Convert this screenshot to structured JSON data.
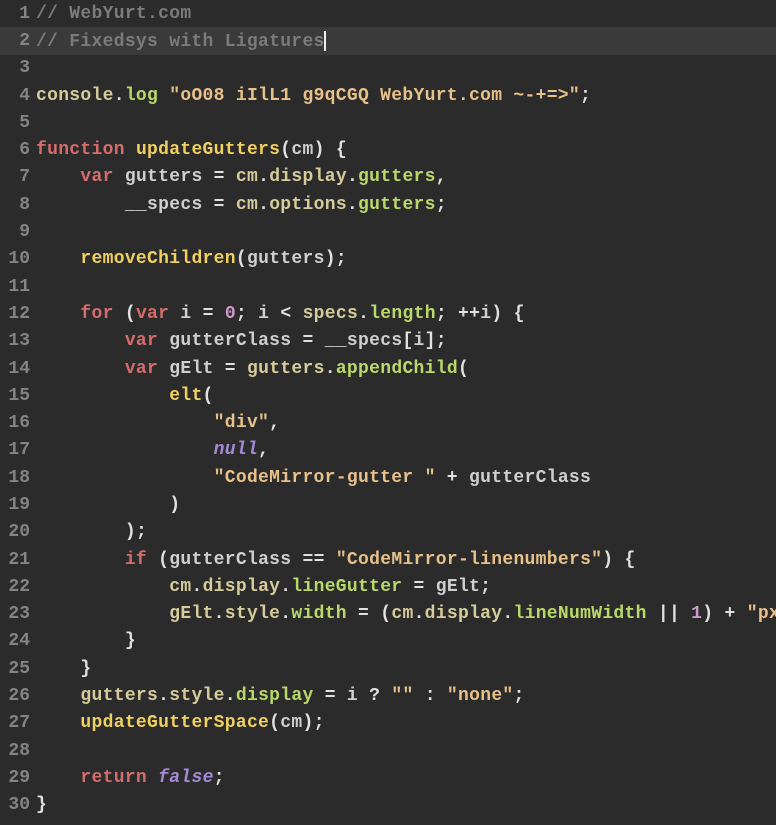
{
  "active_line": 2,
  "lines": [
    {
      "n": 1,
      "tokens": [
        [
          "c-comment",
          "// WebYurt.com"
        ]
      ]
    },
    {
      "n": 2,
      "tokens": [
        [
          "c-comment",
          "// Fixedsys with Ligatures"
        ],
        [
          "cursor",
          ""
        ]
      ]
    },
    {
      "n": 3,
      "tokens": []
    },
    {
      "n": 4,
      "tokens": [
        [
          "c-obj",
          "console"
        ],
        [
          "c-punct",
          "."
        ],
        [
          "c-method",
          "log"
        ],
        [
          "c-default",
          " "
        ],
        [
          "c-string",
          "\"oO08 iIlL1 g9qCGQ WebYurt.com ~-+=>\""
        ],
        [
          "c-punct",
          ";"
        ]
      ]
    },
    {
      "n": 5,
      "tokens": []
    },
    {
      "n": 6,
      "tokens": [
        [
          "c-keyword",
          "function"
        ],
        [
          "c-default",
          " "
        ],
        [
          "c-func",
          "updateGutters"
        ],
        [
          "c-punct",
          "("
        ],
        [
          "c-param",
          "cm"
        ],
        [
          "c-punct",
          ")"
        ],
        [
          "c-default",
          " "
        ],
        [
          "c-brace",
          "{"
        ]
      ]
    },
    {
      "n": 7,
      "tokens": [
        [
          "c-default",
          "    "
        ],
        [
          "c-var",
          "var"
        ],
        [
          "c-default",
          " "
        ],
        [
          "c-ident",
          "gutters"
        ],
        [
          "c-default",
          " "
        ],
        [
          "c-op",
          "="
        ],
        [
          "c-default",
          " "
        ],
        [
          "c-obj",
          "cm"
        ],
        [
          "c-punct",
          "."
        ],
        [
          "c-obj",
          "display"
        ],
        [
          "c-punct",
          "."
        ],
        [
          "c-prop",
          "gutters"
        ],
        [
          "c-punct",
          ","
        ]
      ]
    },
    {
      "n": 8,
      "tokens": [
        [
          "c-default",
          "        "
        ],
        [
          "c-ident",
          "__specs"
        ],
        [
          "c-default",
          " "
        ],
        [
          "c-op",
          "="
        ],
        [
          "c-default",
          " "
        ],
        [
          "c-obj",
          "cm"
        ],
        [
          "c-punct",
          "."
        ],
        [
          "c-obj",
          "options"
        ],
        [
          "c-punct",
          "."
        ],
        [
          "c-prop",
          "gutters"
        ],
        [
          "c-punct",
          ";"
        ]
      ]
    },
    {
      "n": 9,
      "tokens": []
    },
    {
      "n": 10,
      "tokens": [
        [
          "c-default",
          "    "
        ],
        [
          "c-call",
          "removeChildren"
        ],
        [
          "c-punct",
          "("
        ],
        [
          "c-ident",
          "gutters"
        ],
        [
          "c-punct",
          ")"
        ],
        [
          "c-punct",
          ";"
        ]
      ]
    },
    {
      "n": 11,
      "tokens": []
    },
    {
      "n": 12,
      "tokens": [
        [
          "c-default",
          "    "
        ],
        [
          "c-keyword",
          "for"
        ],
        [
          "c-default",
          " "
        ],
        [
          "c-punct",
          "("
        ],
        [
          "c-var",
          "var"
        ],
        [
          "c-default",
          " "
        ],
        [
          "c-ident",
          "i"
        ],
        [
          "c-default",
          " "
        ],
        [
          "c-op",
          "="
        ],
        [
          "c-default",
          " "
        ],
        [
          "c-number",
          "0"
        ],
        [
          "c-punct",
          ";"
        ],
        [
          "c-default",
          " "
        ],
        [
          "c-ident",
          "i"
        ],
        [
          "c-default",
          " "
        ],
        [
          "c-op",
          "<"
        ],
        [
          "c-default",
          " "
        ],
        [
          "c-obj",
          "specs"
        ],
        [
          "c-punct",
          "."
        ],
        [
          "c-prop",
          "length"
        ],
        [
          "c-punct",
          ";"
        ],
        [
          "c-default",
          " "
        ],
        [
          "c-op",
          "++"
        ],
        [
          "c-ident",
          "i"
        ],
        [
          "c-punct",
          ")"
        ],
        [
          "c-default",
          " "
        ],
        [
          "c-brace",
          "{"
        ]
      ]
    },
    {
      "n": 13,
      "tokens": [
        [
          "c-default",
          "        "
        ],
        [
          "c-var",
          "var"
        ],
        [
          "c-default",
          " "
        ],
        [
          "c-ident",
          "gutterClass"
        ],
        [
          "c-default",
          " "
        ],
        [
          "c-op",
          "="
        ],
        [
          "c-default",
          " "
        ],
        [
          "c-ident",
          "__specs"
        ],
        [
          "c-punct",
          "["
        ],
        [
          "c-ident",
          "i"
        ],
        [
          "c-punct",
          "]"
        ],
        [
          "c-punct",
          ";"
        ]
      ]
    },
    {
      "n": 14,
      "tokens": [
        [
          "c-default",
          "        "
        ],
        [
          "c-var",
          "var"
        ],
        [
          "c-default",
          " "
        ],
        [
          "c-ident",
          "gElt"
        ],
        [
          "c-default",
          " "
        ],
        [
          "c-op",
          "="
        ],
        [
          "c-default",
          " "
        ],
        [
          "c-obj",
          "gutters"
        ],
        [
          "c-punct",
          "."
        ],
        [
          "c-method",
          "appendChild"
        ],
        [
          "c-punct",
          "("
        ]
      ]
    },
    {
      "n": 15,
      "tokens": [
        [
          "c-default",
          "            "
        ],
        [
          "c-call",
          "elt"
        ],
        [
          "c-punct",
          "("
        ]
      ]
    },
    {
      "n": 16,
      "tokens": [
        [
          "c-default",
          "                "
        ],
        [
          "c-string",
          "\"div\""
        ],
        [
          "c-punct",
          ","
        ]
      ]
    },
    {
      "n": 17,
      "tokens": [
        [
          "c-default",
          "                "
        ],
        [
          "c-const",
          "null"
        ],
        [
          "c-punct",
          ","
        ]
      ]
    },
    {
      "n": 18,
      "tokens": [
        [
          "c-default",
          "                "
        ],
        [
          "c-string",
          "\"CodeMirror-gutter \""
        ],
        [
          "c-default",
          " "
        ],
        [
          "c-op",
          "+"
        ],
        [
          "c-default",
          " "
        ],
        [
          "c-ident",
          "gutterClass"
        ]
      ]
    },
    {
      "n": 19,
      "tokens": [
        [
          "c-default",
          "            "
        ],
        [
          "c-punct",
          ")"
        ]
      ]
    },
    {
      "n": 20,
      "tokens": [
        [
          "c-default",
          "        "
        ],
        [
          "c-punct",
          ")"
        ],
        [
          "c-punct",
          ";"
        ]
      ]
    },
    {
      "n": 21,
      "tokens": [
        [
          "c-default",
          "        "
        ],
        [
          "c-keyword",
          "if"
        ],
        [
          "c-default",
          " "
        ],
        [
          "c-punct",
          "("
        ],
        [
          "c-ident",
          "gutterClass"
        ],
        [
          "c-default",
          " "
        ],
        [
          "c-op",
          "=="
        ],
        [
          "c-default",
          " "
        ],
        [
          "c-string",
          "\"CodeMirror-linenumbers\""
        ],
        [
          "c-punct",
          ")"
        ],
        [
          "c-default",
          " "
        ],
        [
          "c-brace",
          "{"
        ]
      ]
    },
    {
      "n": 22,
      "tokens": [
        [
          "c-default",
          "            "
        ],
        [
          "c-obj",
          "cm"
        ],
        [
          "c-punct",
          "."
        ],
        [
          "c-obj",
          "display"
        ],
        [
          "c-punct",
          "."
        ],
        [
          "c-prop",
          "lineGutter"
        ],
        [
          "c-default",
          " "
        ],
        [
          "c-op",
          "="
        ],
        [
          "c-default",
          " "
        ],
        [
          "c-ident",
          "gElt"
        ],
        [
          "c-punct",
          ";"
        ]
      ]
    },
    {
      "n": 23,
      "tokens": [
        [
          "c-default",
          "            "
        ],
        [
          "c-obj",
          "gElt"
        ],
        [
          "c-punct",
          "."
        ],
        [
          "c-obj",
          "style"
        ],
        [
          "c-punct",
          "."
        ],
        [
          "c-prop",
          "width"
        ],
        [
          "c-default",
          " "
        ],
        [
          "c-op",
          "="
        ],
        [
          "c-default",
          " "
        ],
        [
          "c-punct",
          "("
        ],
        [
          "c-obj",
          "cm"
        ],
        [
          "c-punct",
          "."
        ],
        [
          "c-obj",
          "display"
        ],
        [
          "c-punct",
          "."
        ],
        [
          "c-prop",
          "lineNumWidth"
        ],
        [
          "c-default",
          " "
        ],
        [
          "c-op",
          "||"
        ],
        [
          "c-default",
          " "
        ],
        [
          "c-number",
          "1"
        ],
        [
          "c-punct",
          ")"
        ],
        [
          "c-default",
          " "
        ],
        [
          "c-op",
          "+"
        ],
        [
          "c-default",
          " "
        ],
        [
          "c-string",
          "\"px\""
        ]
      ]
    },
    {
      "n": 24,
      "tokens": [
        [
          "c-default",
          "        "
        ],
        [
          "c-brace",
          "}"
        ]
      ]
    },
    {
      "n": 25,
      "tokens": [
        [
          "c-default",
          "    "
        ],
        [
          "c-brace",
          "}"
        ]
      ]
    },
    {
      "n": 26,
      "tokens": [
        [
          "c-default",
          "    "
        ],
        [
          "c-obj",
          "gutters"
        ],
        [
          "c-punct",
          "."
        ],
        [
          "c-obj",
          "style"
        ],
        [
          "c-punct",
          "."
        ],
        [
          "c-prop",
          "display"
        ],
        [
          "c-default",
          " "
        ],
        [
          "c-op",
          "="
        ],
        [
          "c-default",
          " "
        ],
        [
          "c-ident",
          "i"
        ],
        [
          "c-default",
          " "
        ],
        [
          "c-op",
          "?"
        ],
        [
          "c-default",
          " "
        ],
        [
          "c-string",
          "\"\""
        ],
        [
          "c-default",
          " "
        ],
        [
          "c-op",
          ":"
        ],
        [
          "c-default",
          " "
        ],
        [
          "c-string",
          "\"none\""
        ],
        [
          "c-punct",
          ";"
        ]
      ]
    },
    {
      "n": 27,
      "tokens": [
        [
          "c-default",
          "    "
        ],
        [
          "c-call",
          "updateGutterSpace"
        ],
        [
          "c-punct",
          "("
        ],
        [
          "c-ident",
          "cm"
        ],
        [
          "c-punct",
          ")"
        ],
        [
          "c-punct",
          ";"
        ]
      ]
    },
    {
      "n": 28,
      "tokens": []
    },
    {
      "n": 29,
      "tokens": [
        [
          "c-default",
          "    "
        ],
        [
          "c-keyword",
          "return"
        ],
        [
          "c-default",
          " "
        ],
        [
          "c-const",
          "false"
        ],
        [
          "c-punct",
          ";"
        ]
      ]
    },
    {
      "n": 30,
      "tokens": [
        [
          "c-brace",
          "}"
        ]
      ]
    }
  ]
}
